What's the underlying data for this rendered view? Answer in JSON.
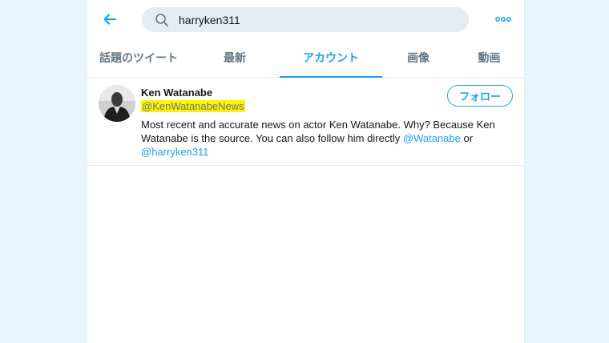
{
  "colors": {
    "accent": "#1da1f2",
    "text": "#14171a",
    "secondary": "#657786",
    "highlight": "#fff200",
    "background": "#e8f5fd"
  },
  "header": {
    "back_icon": "arrow-left-icon",
    "search": {
      "value": "harryken311",
      "icon": "search-icon"
    },
    "more_icon": "more-horizontal-icon"
  },
  "tabs": [
    {
      "label": "話題のツイート",
      "active": false
    },
    {
      "label": "最新",
      "active": false
    },
    {
      "label": "アカウント",
      "active": true
    },
    {
      "label": "画像",
      "active": false
    },
    {
      "label": "動画",
      "active": false
    }
  ],
  "accounts": [
    {
      "name": "Ken Watanabe",
      "handle": "@KenWatanabeNews",
      "follow_label": "フォロー",
      "bio_text": "Most recent and accurate news on actor Ken Watanabe. Why? Because Ken Watanabe is the source. You can also follow him directly",
      "bio_link1": "@Watanabe",
      "bio_or": "or",
      "bio_link2": "@harryken311"
    }
  ]
}
